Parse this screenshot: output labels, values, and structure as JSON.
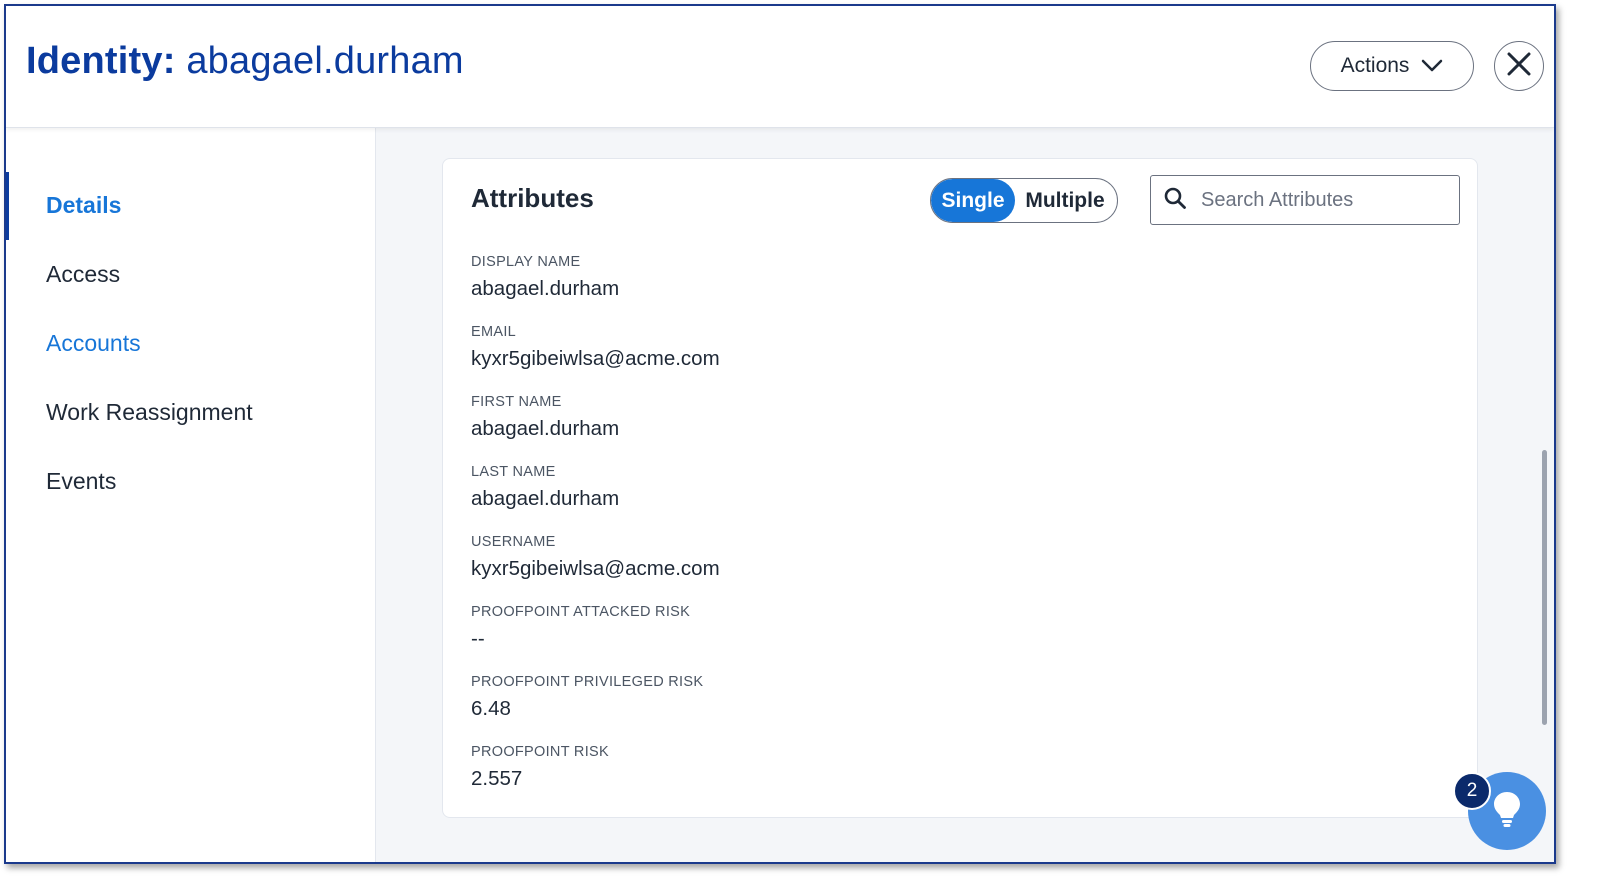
{
  "header": {
    "title_label": "Identity:",
    "title_value": "abagael.durham",
    "actions_label": "Actions"
  },
  "sidebar": {
    "items": [
      {
        "label": "Details",
        "state": "active"
      },
      {
        "label": "Access",
        "state": "default"
      },
      {
        "label": "Accounts",
        "state": "link"
      },
      {
        "label": "Work Reassignment",
        "state": "default"
      },
      {
        "label": "Events",
        "state": "default"
      }
    ]
  },
  "card": {
    "title": "Attributes",
    "toggle": {
      "single": "Single",
      "multiple": "Multiple",
      "selected": "Single"
    },
    "search": {
      "placeholder": "Search Attributes",
      "value": ""
    },
    "attributes": [
      {
        "label": "DISPLAY NAME",
        "value": "abagael.durham"
      },
      {
        "label": "EMAIL",
        "value": "kyxr5gibeiwlsa@acme.com"
      },
      {
        "label": "FIRST NAME",
        "value": "abagael.durham"
      },
      {
        "label": "LAST NAME",
        "value": "abagael.durham"
      },
      {
        "label": "USERNAME",
        "value": "kyxr5gibeiwlsa@acme.com"
      },
      {
        "label": "PROOFPOINT ATTACKED RISK",
        "value": "--"
      },
      {
        "label": "PROOFPOINT PRIVILEGED RISK",
        "value": "6.48"
      },
      {
        "label": "PROOFPOINT RISK",
        "value": "2.557"
      }
    ]
  },
  "help": {
    "badge_count": "2",
    "icon": "lightbulb-icon"
  },
  "colors": {
    "brand_blue": "#0b3b9e",
    "accent_blue": "#1776d8",
    "fab_blue": "#4a90e2",
    "badge_navy": "#0b2a6b"
  }
}
